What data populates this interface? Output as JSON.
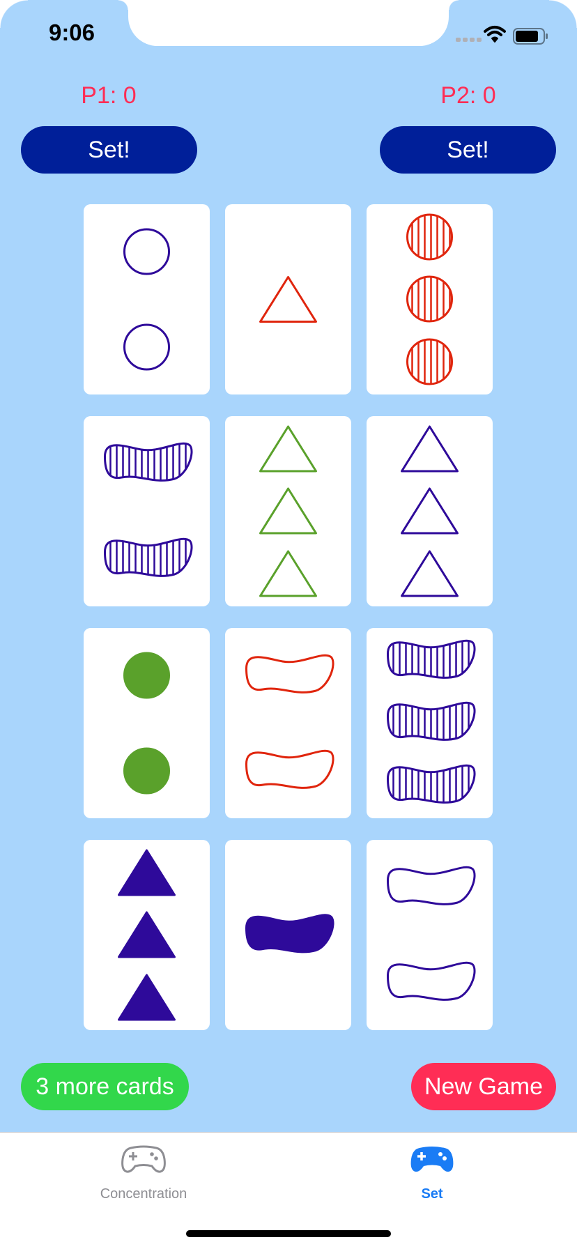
{
  "status_bar": {
    "time": "9:06"
  },
  "scores": {
    "p1": "P1: 0",
    "p2": "P2: 0"
  },
  "buttons": {
    "p1_set": "Set!",
    "p2_set": "Set!",
    "more_cards": "3 more cards",
    "new_game": "New Game"
  },
  "colors": {
    "background": "#a9d5fc",
    "set_button": "#001f99",
    "score_text": "#ff2d55",
    "more_cards_button": "#32d74b",
    "new_game_button": "#ff2d55",
    "tab_active": "#1a7cf5",
    "tab_inactive": "#8e8e93",
    "card_purple": "#2e0a9a",
    "card_red": "#e0250d",
    "card_green": "#5aa12b"
  },
  "cards": [
    {
      "count": 2,
      "shape": "oval",
      "color": "purple",
      "shading": "open"
    },
    {
      "count": 1,
      "shape": "diamond",
      "color": "red",
      "shading": "open"
    },
    {
      "count": 3,
      "shape": "oval",
      "color": "red",
      "shading": "striped"
    },
    {
      "count": 2,
      "shape": "squiggle",
      "color": "purple",
      "shading": "striped"
    },
    {
      "count": 3,
      "shape": "diamond",
      "color": "green",
      "shading": "open"
    },
    {
      "count": 3,
      "shape": "diamond",
      "color": "purple",
      "shading": "open"
    },
    {
      "count": 2,
      "shape": "oval",
      "color": "green",
      "shading": "solid"
    },
    {
      "count": 2,
      "shape": "squiggle",
      "color": "red",
      "shading": "open"
    },
    {
      "count": 3,
      "shape": "squiggle",
      "color": "purple",
      "shading": "striped"
    },
    {
      "count": 3,
      "shape": "diamond",
      "color": "purple",
      "shading": "solid"
    },
    {
      "count": 1,
      "shape": "squiggle",
      "color": "purple",
      "shading": "solid"
    },
    {
      "count": 2,
      "shape": "squiggle",
      "color": "purple",
      "shading": "open"
    }
  ],
  "tabs": [
    {
      "label": "Concentration",
      "icon": "gamecontroller-outline-icon",
      "selected": false
    },
    {
      "label": "Set",
      "icon": "gamecontroller-filled-icon",
      "selected": true
    }
  ]
}
